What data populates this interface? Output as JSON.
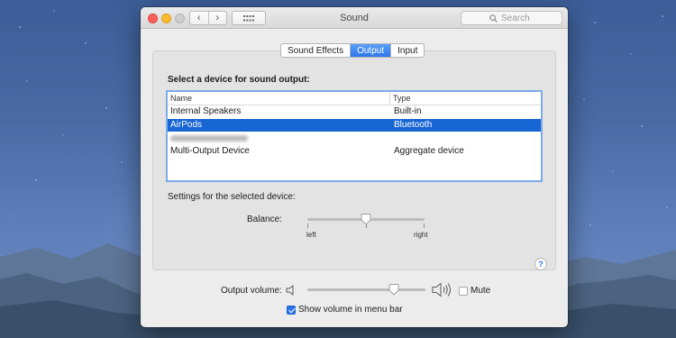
{
  "window": {
    "title": "Sound",
    "search_placeholder": "Search",
    "nav_back": "‹",
    "nav_forward": "›"
  },
  "tabs": [
    {
      "label": "Sound Effects",
      "active": false
    },
    {
      "label": "Output",
      "active": true
    },
    {
      "label": "Input",
      "active": false
    }
  ],
  "output": {
    "section_title": "Select a device for sound output:",
    "columns": [
      "Name",
      "Type"
    ],
    "devices": [
      {
        "name": "Internal Speakers",
        "type": "Built-in",
        "selected": false
      },
      {
        "name": "AirPods",
        "type": "Bluetooth",
        "selected": true
      },
      {
        "name": "",
        "type": "",
        "selected": false,
        "blurred": true
      },
      {
        "name": "Multi-Output Device",
        "type": "Aggregate device",
        "selected": false
      }
    ],
    "settings_label": "Settings for the selected device:",
    "balance": {
      "label": "Balance:",
      "left_label": "left",
      "right_label": "right",
      "value": 0.5
    },
    "help_label": "?"
  },
  "volume": {
    "label": "Output volume:",
    "level": 0.73,
    "mute_label": "Mute",
    "muted": false,
    "show_in_menubar_label": "Show volume in menu bar",
    "show_in_menubar": true
  },
  "colors": {
    "accent": "#2d74e9",
    "selection": "#1866d3",
    "window_bg": "#ececec"
  },
  "icons": [
    "search-icon",
    "grid-icon",
    "speaker-low-icon",
    "speaker-high-icon",
    "help-icon",
    "checkmark-icon"
  ]
}
